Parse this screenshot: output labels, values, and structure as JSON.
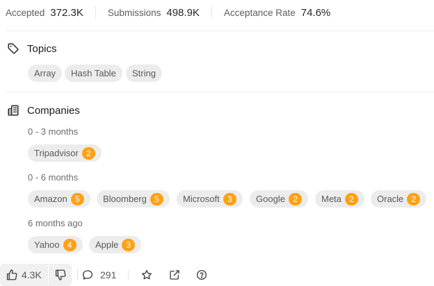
{
  "stats": {
    "accepted_label": "Accepted",
    "accepted_value": "372.3K",
    "submissions_label": "Submissions",
    "submissions_value": "498.9K",
    "acceptance_label": "Acceptance Rate",
    "acceptance_value": "74.6%"
  },
  "topics": {
    "title": "Topics",
    "tags": [
      "Array",
      "Hash Table",
      "String"
    ]
  },
  "companies": {
    "title": "Companies",
    "groups": [
      {
        "period": "0 - 3 months",
        "items": [
          {
            "name": "Tripadvisor",
            "count": "2"
          }
        ]
      },
      {
        "period": "0 - 6 months",
        "items": [
          {
            "name": "Amazon",
            "count": "5"
          },
          {
            "name": "Bloomberg",
            "count": "5"
          },
          {
            "name": "Microsoft",
            "count": "3"
          },
          {
            "name": "Google",
            "count": "2"
          },
          {
            "name": "Meta",
            "count": "2"
          },
          {
            "name": "Oracle",
            "count": "2"
          }
        ]
      },
      {
        "period": "6 months ago",
        "items": [
          {
            "name": "Yahoo",
            "count": "4"
          },
          {
            "name": "Apple",
            "count": "3"
          }
        ]
      }
    ]
  },
  "footer": {
    "likes": "4.3K",
    "comments": "291",
    "icons": [
      "thumbs-up-icon",
      "thumbs-down-icon",
      "comment-icon",
      "star-icon",
      "share-icon",
      "help-icon"
    ]
  },
  "colors": {
    "badge": "#ffa116",
    "chip_bg": "#ececec",
    "text_muted": "#595959"
  }
}
